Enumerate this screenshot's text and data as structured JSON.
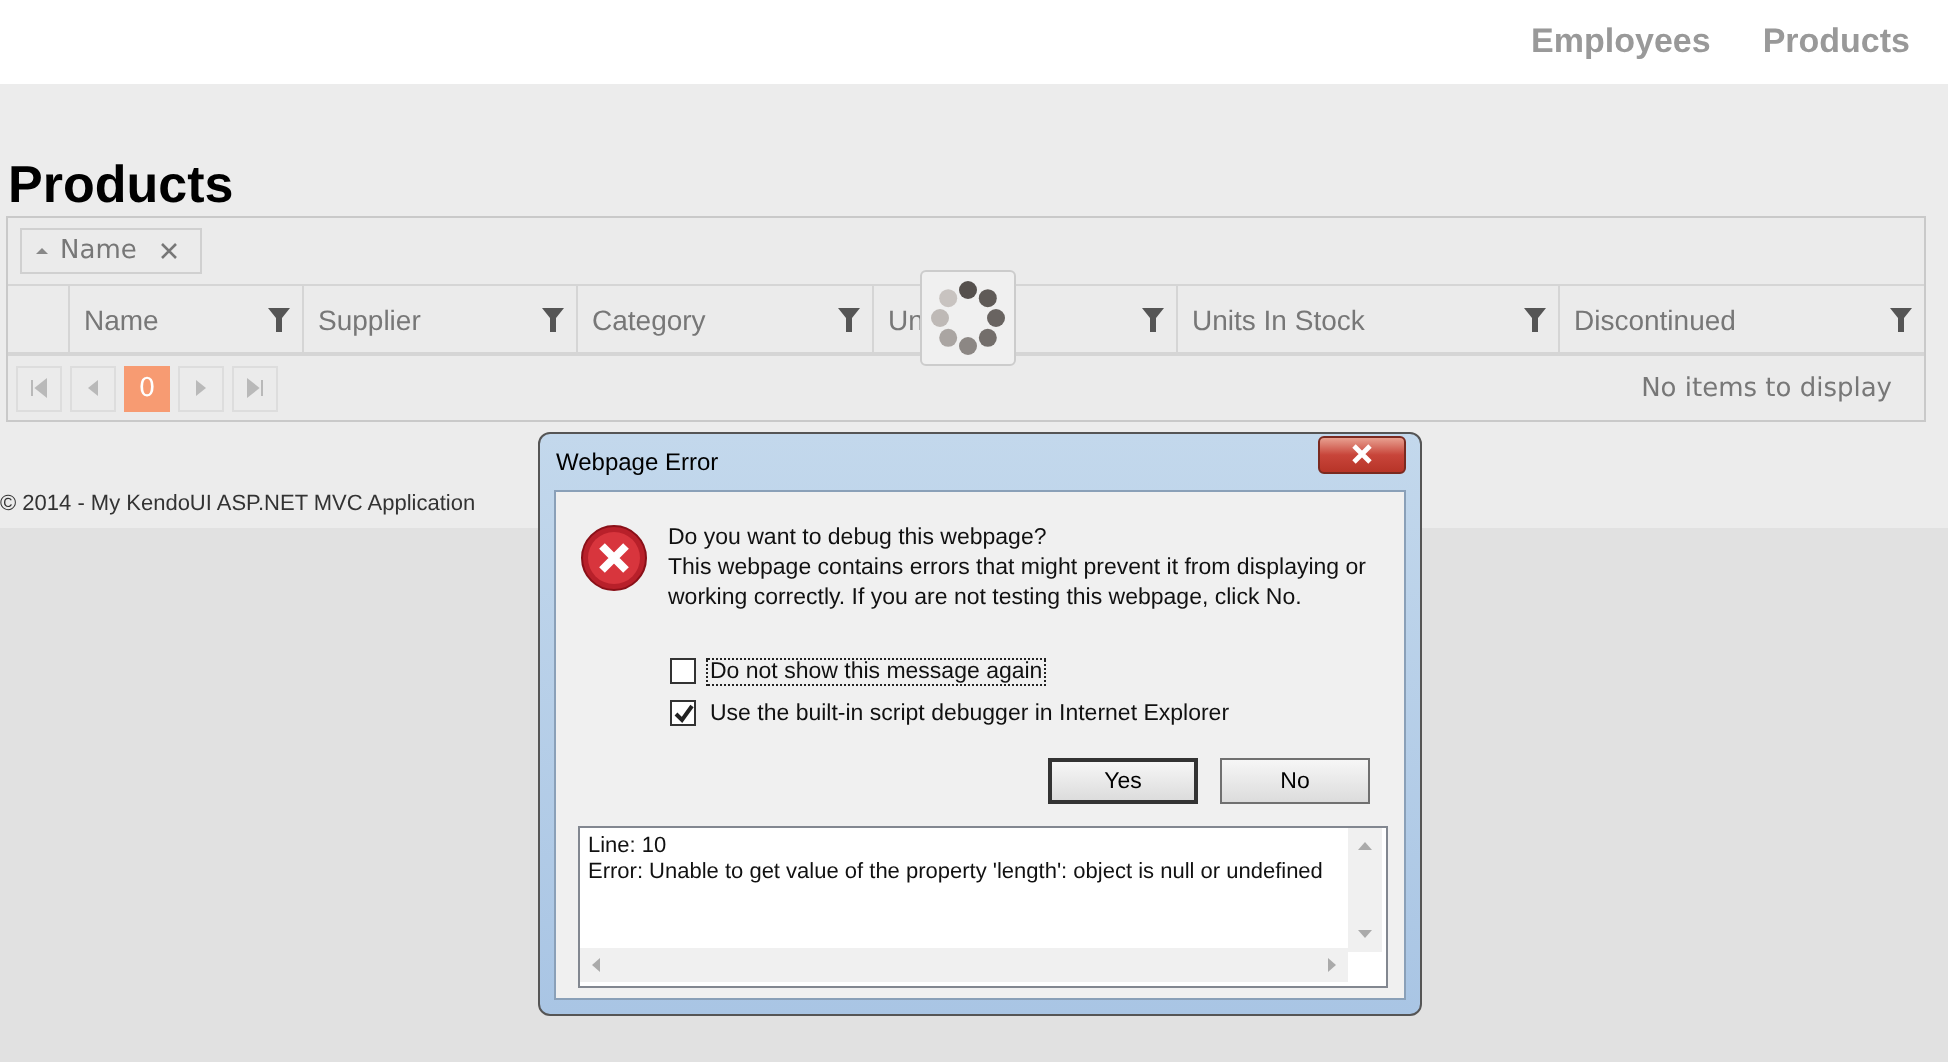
{
  "nav": [
    {
      "label": "Employees"
    },
    {
      "label": "Products"
    }
  ],
  "page_title": "Products",
  "grid": {
    "group_chip": {
      "label": "Name",
      "sort_ascending": true
    },
    "columns": [
      {},
      {
        "label": "Name"
      },
      {
        "label": "Supplier"
      },
      {
        "label": "Category"
      },
      {
        "label": "Un"
      },
      {
        "label": "Units In Stock"
      },
      {
        "label": "Discontinued"
      }
    ],
    "pager": {
      "nav": [
        {
          "kind": "first",
          "disabled": true
        },
        {
          "kind": "prev",
          "disabled": true
        },
        {
          "kind": "page",
          "label": "0",
          "selected": true
        },
        {
          "kind": "next",
          "disabled": true
        },
        {
          "kind": "last",
          "disabled": true
        }
      ],
      "info": "No items to display"
    },
    "loading": true
  },
  "footer": "© 2014 - My KendoUI ASP.NET MVC Application",
  "dialog": {
    "title": "Webpage Error",
    "heading": "Do you want to debug this webpage?",
    "message": "This webpage contains errors that might prevent it from displaying or working correctly. If you are not testing this webpage, click No.",
    "checkboxes": [
      {
        "label": "Do not show this message again",
        "checked": false,
        "focused": true
      },
      {
        "label": "Use the built-in script debugger in Internet Explorer",
        "checked": true,
        "focused": false
      }
    ],
    "buttons": [
      {
        "label": "Yes",
        "default": true
      },
      {
        "label": "No",
        "default": false
      }
    ],
    "details": [
      "Line: 10",
      "Error: Unable to get value of the property 'length': object is null or undefined"
    ]
  }
}
